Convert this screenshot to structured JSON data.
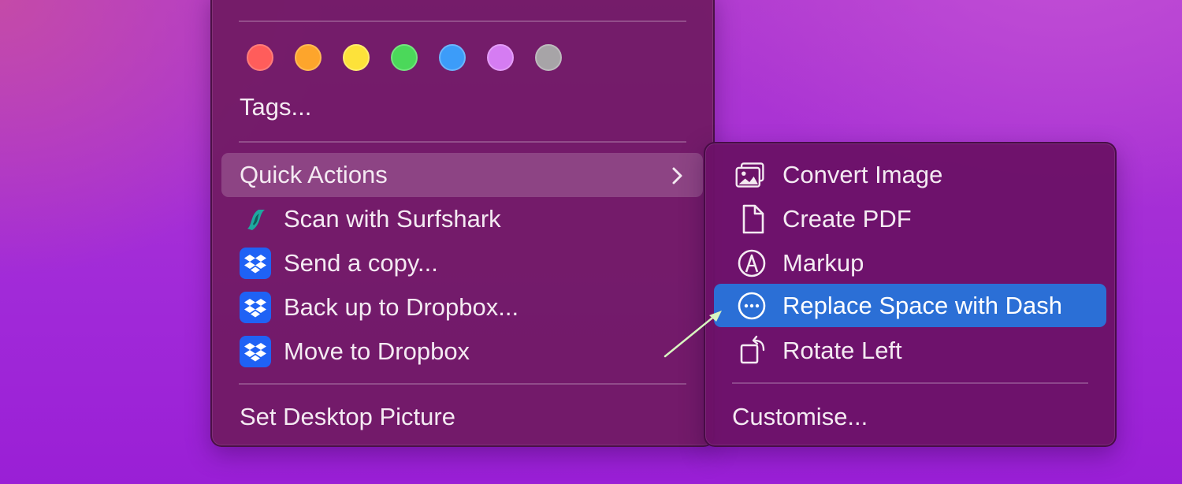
{
  "main_menu": {
    "tag_colors": [
      {
        "name": "red",
        "color": "#ff5d5b"
      },
      {
        "name": "orange",
        "color": "#fda52c"
      },
      {
        "name": "yellow",
        "color": "#fde23a"
      },
      {
        "name": "green",
        "color": "#4bd85a"
      },
      {
        "name": "blue",
        "color": "#3c9cf9"
      },
      {
        "name": "purple",
        "color": "#d57cf2"
      },
      {
        "name": "gray",
        "color": "#a7a4a7"
      }
    ],
    "tags_label": "Tags...",
    "quick_actions_label": "Quick Actions",
    "items": [
      {
        "label": "Scan with Surfshark",
        "icon": "surfshark-icon"
      },
      {
        "label": "Send a copy...",
        "icon": "dropbox-icon"
      },
      {
        "label": "Back up to Dropbox...",
        "icon": "dropbox-icon"
      },
      {
        "label": "Move to Dropbox",
        "icon": "dropbox-icon"
      }
    ],
    "set_desktop_label": "Set Desktop Picture"
  },
  "sub_menu": {
    "items": [
      {
        "label": "Convert Image",
        "icon": "photos-icon"
      },
      {
        "label": "Create PDF",
        "icon": "document-icon"
      },
      {
        "label": "Markup",
        "icon": "markup-pen-icon"
      },
      {
        "label": "Replace Space with Dash",
        "icon": "ellipsis-circle-icon",
        "selected": true
      },
      {
        "label": "Rotate Left",
        "icon": "rotate-left-icon"
      }
    ],
    "customise_label": "Customise..."
  },
  "colors": {
    "selection": "#2b6fd6",
    "dropbox_blue": "#1f62f5",
    "surfshark_teal": "#1ea8a0",
    "annotation_arrow": "#d8f5c0"
  }
}
